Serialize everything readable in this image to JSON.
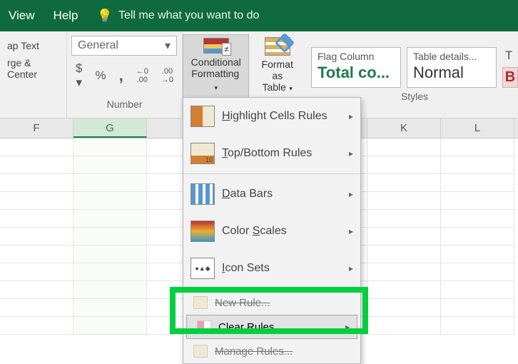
{
  "menu": {
    "view": "View",
    "help": "Help",
    "tell_me": "Tell me what you want to do"
  },
  "ribbon": {
    "align": {
      "wrap": "ap Text",
      "merge": "rge & Center"
    },
    "number": {
      "format": "General",
      "label": "Number",
      "currency": "$",
      "percent": "%",
      "comma": ",",
      "inc": ".0",
      "dec": ".00"
    },
    "cf": {
      "label1": "Conditional",
      "label2": "Formatting"
    },
    "fat": {
      "label1": "Format as",
      "label2": "Table"
    },
    "styles": {
      "flag_title": "Flag Column",
      "flag_value": "Total co...",
      "details_title": "Table details...",
      "details_value": "Normal",
      "t": "T",
      "b": "B",
      "label": "Styles"
    }
  },
  "columns": [
    "F",
    "G",
    "",
    "",
    "",
    "K",
    "L"
  ],
  "dropdown": {
    "highlight": "Highlight Cells Rules",
    "topbottom": "Top/Bottom Rules",
    "databars": "Data Bars",
    "colorscales": "Color Scales",
    "iconsets": "Icon Sets",
    "new_rule_cut": "New Rule...",
    "clear": "Clear Rules",
    "manage_cut": "Manage Rules...",
    "underline_letters": {
      "highlight": "H",
      "topbottom": "T",
      "databars": "D",
      "colorscales": "S",
      "iconsets": "I",
      "clear": "C"
    }
  }
}
